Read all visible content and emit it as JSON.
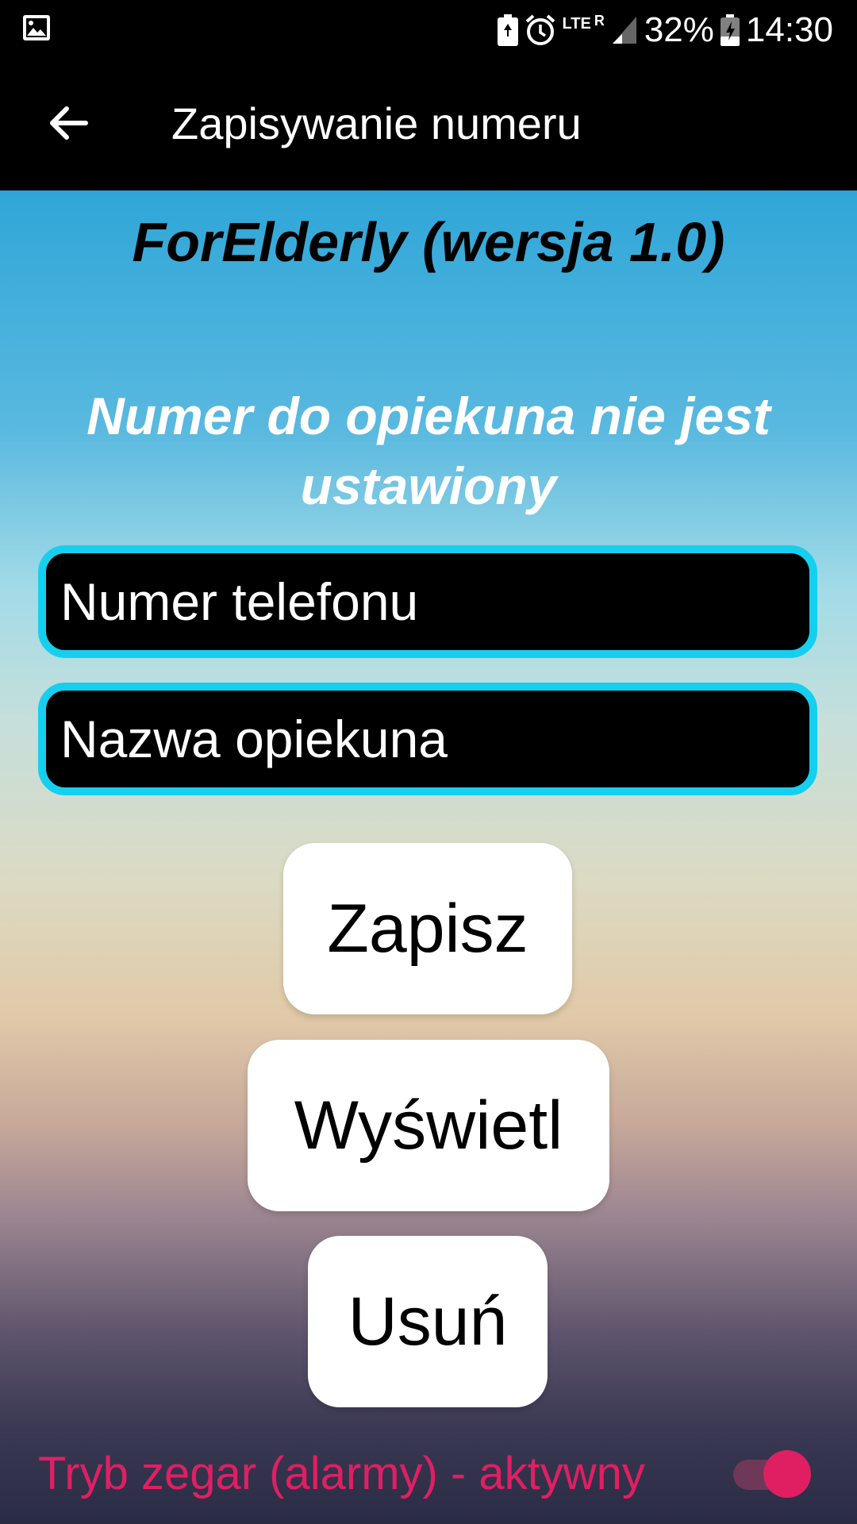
{
  "status_bar": {
    "network": "LTE",
    "roaming": "R",
    "battery": "32%",
    "time": "14:30",
    "icons": [
      "gallery-icon",
      "battery-saver-icon",
      "alarm-icon",
      "lte-icon",
      "signal-icon",
      "battery-charging-icon"
    ]
  },
  "app_bar": {
    "title": "Zapisywanie numeru",
    "back_icon": "arrow-left-icon"
  },
  "main": {
    "version": "ForElderly (wersja 1.0)",
    "status_message": "Numer do opiekuna nie jest ustawiony",
    "phone_placeholder": "Numer telefonu",
    "name_placeholder": "Nazwa opiekuna",
    "save_label": "Zapisz",
    "show_label": "Wyświetl",
    "delete_label": "Usuń",
    "clock_mode_label": "Tryb zegar (alarmy) - aktywny",
    "clock_mode_enabled": true
  },
  "colors": {
    "accent_pink": "#e01f63",
    "input_border": "#16cfee"
  }
}
